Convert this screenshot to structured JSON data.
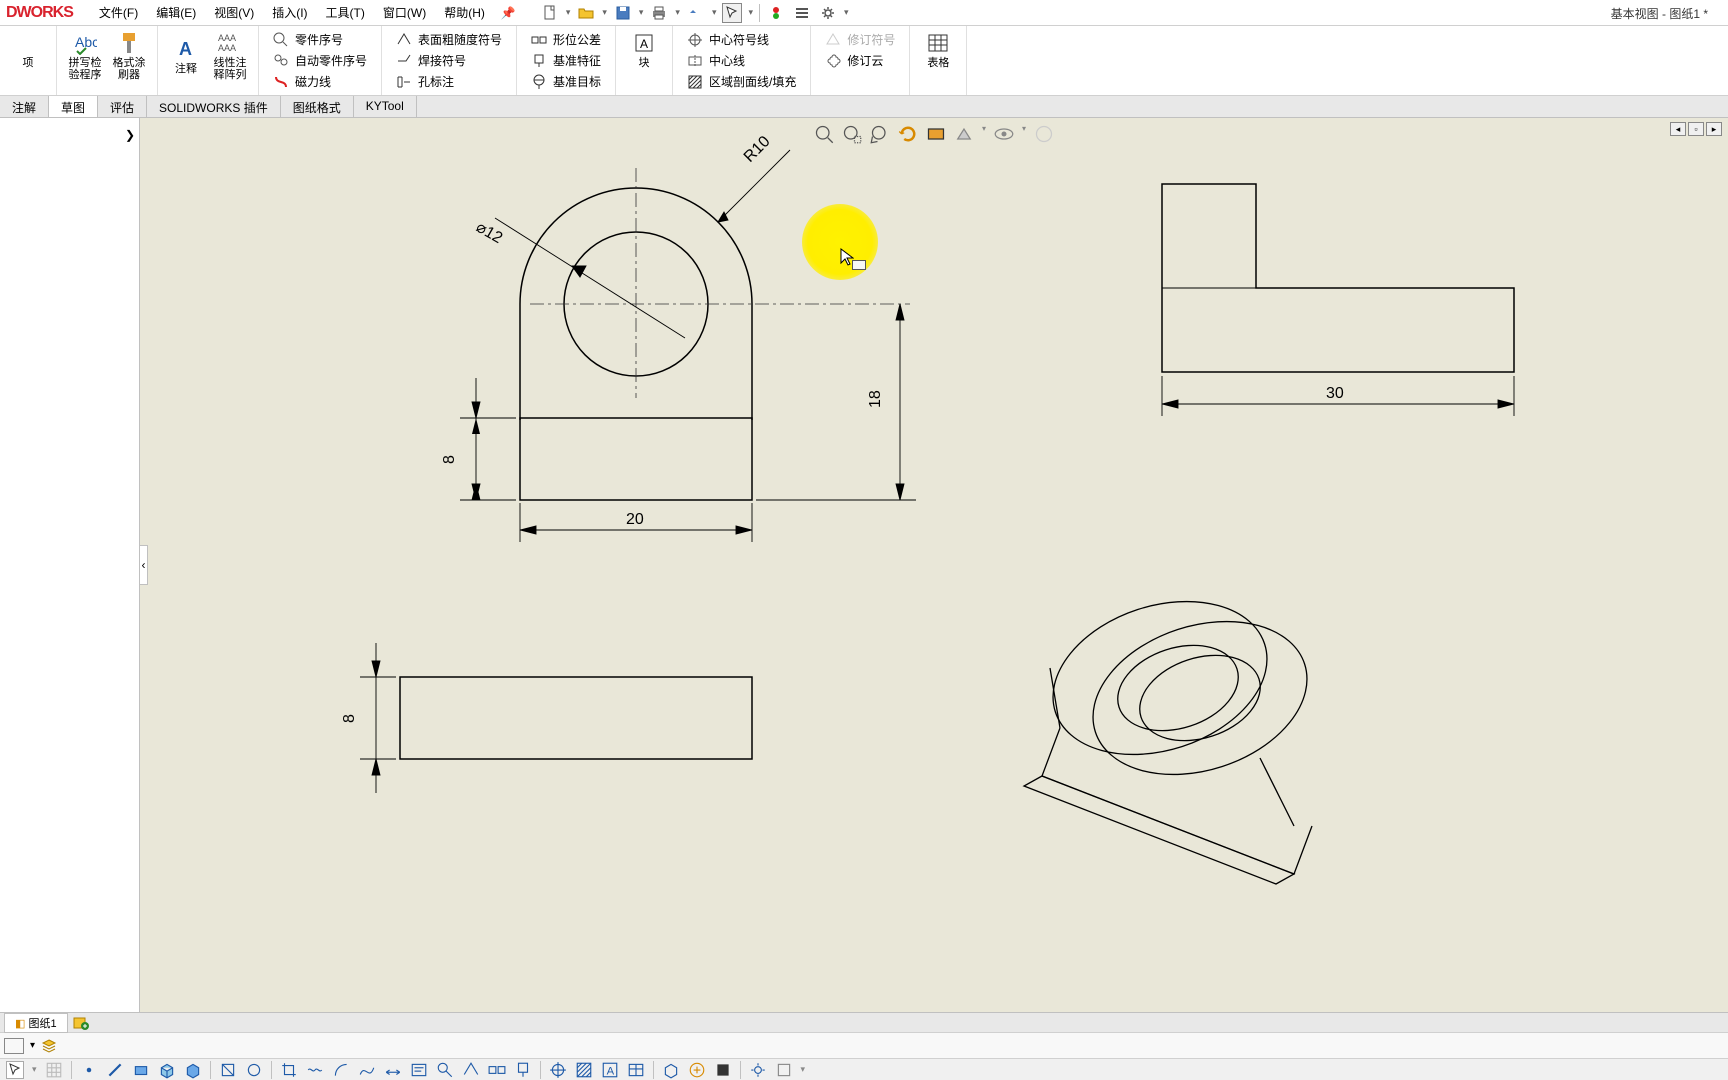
{
  "app": {
    "logo": "DWORKS",
    "title": "基本视图 - 图纸1 *"
  },
  "menu": {
    "file": "文件(F)",
    "edit": "编辑(E)",
    "view": "视图(V)",
    "insert": "插入(I)",
    "tools": "工具(T)",
    "window": "窗口(W)",
    "help": "帮助(H)"
  },
  "ribbon": {
    "big": {
      "option": "项",
      "spellcheck": "拼写检\n验程序",
      "formatbrush": "格式涂\n刷器",
      "annotate": "注释",
      "linearpattern": "线性注\n释阵列",
      "block": "块",
      "tables": "表格"
    },
    "col1": {
      "balloon": "零件序号",
      "autoballoon": "自动零件序号",
      "magline": "磁力线"
    },
    "col2": {
      "surface": "表面粗随度符号",
      "weld": "焊接符号",
      "hole": "孔标注"
    },
    "col3": {
      "geotol": "形位公差",
      "datum": "基准特征",
      "datumtgt": "基准目标"
    },
    "col4": {
      "centermark": "中心符号线",
      "centerline": "中心线",
      "hatch": "区域剖面线/填充"
    },
    "col5": {
      "revsym": "修订符号",
      "revcloud": "修订云"
    }
  },
  "tabs": {
    "annotate": "注解",
    "sketch": "草图",
    "evaluate": "评估",
    "addins": "SOLIDWORKS 插件",
    "sheetfmt": "图纸格式",
    "kytool": "KYTool"
  },
  "drawing": {
    "dims": {
      "r10": "R10",
      "d12": "⌀12",
      "w20": "20",
      "h18": "18",
      "h8a": "8",
      "h8b": "8",
      "w30": "30"
    }
  },
  "sheet": {
    "tab1": "图纸1"
  }
}
